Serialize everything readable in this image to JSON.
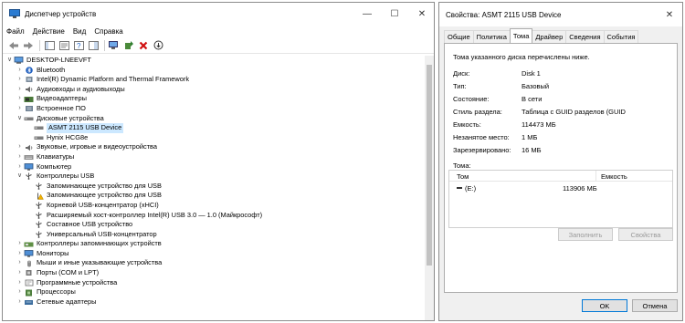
{
  "device_manager": {
    "title": "Диспетчер устройств",
    "menu": [
      "Файл",
      "Действие",
      "Вид",
      "Справка"
    ],
    "tree": [
      {
        "label": "DESKTOP-LNEEVFT",
        "level": 0,
        "expander": "v",
        "icon": "computer-icon"
      },
      {
        "label": "Bluetooth",
        "level": 1,
        "expander": ">",
        "icon": "bluetooth-icon"
      },
      {
        "label": "Intel(R) Dynamic Platform and Thermal Framework",
        "level": 1,
        "expander": ">",
        "icon": "chip-icon"
      },
      {
        "label": "Аудиовходы и аудиовыходы",
        "level": 1,
        "expander": ">",
        "icon": "speaker-icon"
      },
      {
        "label": "Видеоадаптеры",
        "level": 1,
        "expander": ">",
        "icon": "display-adapter-icon"
      },
      {
        "label": "Встроенное ПО",
        "level": 1,
        "expander": ">",
        "icon": "firmware-icon"
      },
      {
        "label": "Дисковые устройства",
        "level": 1,
        "expander": "v",
        "icon": "disk-icon"
      },
      {
        "label": "ASMT 2115 USB Device",
        "level": 2,
        "expander": "",
        "icon": "disk-icon",
        "selected": true
      },
      {
        "label": "Hynix HCG8e",
        "level": 2,
        "expander": "",
        "icon": "disk-icon"
      },
      {
        "label": "Звуковые, игровые и видеоустройства",
        "level": 1,
        "expander": ">",
        "icon": "speaker-icon"
      },
      {
        "label": "Клавиатуры",
        "level": 1,
        "expander": ">",
        "icon": "keyboard-icon"
      },
      {
        "label": "Компьютер",
        "level": 1,
        "expander": ">",
        "icon": "monitor-icon"
      },
      {
        "label": "Контроллеры USB",
        "level": 1,
        "expander": "v",
        "icon": "usb-icon"
      },
      {
        "label": "Запоминающее устройство для USB",
        "level": 2,
        "expander": "",
        "icon": "usb-icon"
      },
      {
        "label": "Запоминающее устройство для USB",
        "level": 2,
        "expander": "",
        "icon": "usb-warning-icon"
      },
      {
        "label": "Корневой USB-концентратор (xHCI)",
        "level": 2,
        "expander": "",
        "icon": "usb-icon"
      },
      {
        "label": "Расширяемый хост-контроллер Intel(R) USB 3.0 — 1.0 (Майкрософт)",
        "level": 2,
        "expander": "",
        "icon": "usb-icon"
      },
      {
        "label": "Составное USB устройство",
        "level": 2,
        "expander": "",
        "icon": "usb-icon"
      },
      {
        "label": "Универсальный USB-концентратор",
        "level": 2,
        "expander": "",
        "icon": "usb-icon"
      },
      {
        "label": "Контроллеры запоминающих устройств",
        "level": 1,
        "expander": ">",
        "icon": "storage-controller-icon"
      },
      {
        "label": "Мониторы",
        "level": 1,
        "expander": ">",
        "icon": "monitor-icon"
      },
      {
        "label": "Мыши и иные указывающие устройства",
        "level": 1,
        "expander": ">",
        "icon": "mouse-icon"
      },
      {
        "label": "Порты (COM и LPT)",
        "level": 1,
        "expander": ">",
        "icon": "port-icon"
      },
      {
        "label": "Программные устройства",
        "level": 1,
        "expander": ">",
        "icon": "software-device-icon"
      },
      {
        "label": "Процессоры",
        "level": 1,
        "expander": ">",
        "icon": "processor-icon"
      },
      {
        "label": "Сетевые адаптеры",
        "level": 1,
        "expander": ">",
        "icon": "network-icon"
      }
    ]
  },
  "properties": {
    "title": "Свойства: ASMT 2115 USB Device",
    "tabs": [
      "Общие",
      "Политика",
      "Тома",
      "Драйвер",
      "Сведения",
      "События"
    ],
    "active_tab": "Тома",
    "intro": "Тома указанного диска перечислены ниже.",
    "fields": [
      {
        "label": "Диск:",
        "value": "Disk 1"
      },
      {
        "label": "Тип:",
        "value": "Базовый"
      },
      {
        "label": "Состояние:",
        "value": "В сети"
      },
      {
        "label": "Стиль раздела:",
        "value": "Таблица с GUID разделов (GUID"
      },
      {
        "label": "Емкость:",
        "value": "114473 МБ"
      },
      {
        "label": "Незанятое место:",
        "value": "1 МБ"
      },
      {
        "label": "Зарезервировано:",
        "value": "16 МБ"
      }
    ],
    "volumes_label": "Тома:",
    "volumes_columns": [
      "Том",
      "Емкость"
    ],
    "volumes": [
      {
        "name": "(E:)",
        "capacity": "113906 МБ"
      }
    ],
    "populate_button": "Заполнить",
    "properties_button": "Свойства",
    "ok_button": "OK",
    "cancel_button": "Отмена"
  }
}
